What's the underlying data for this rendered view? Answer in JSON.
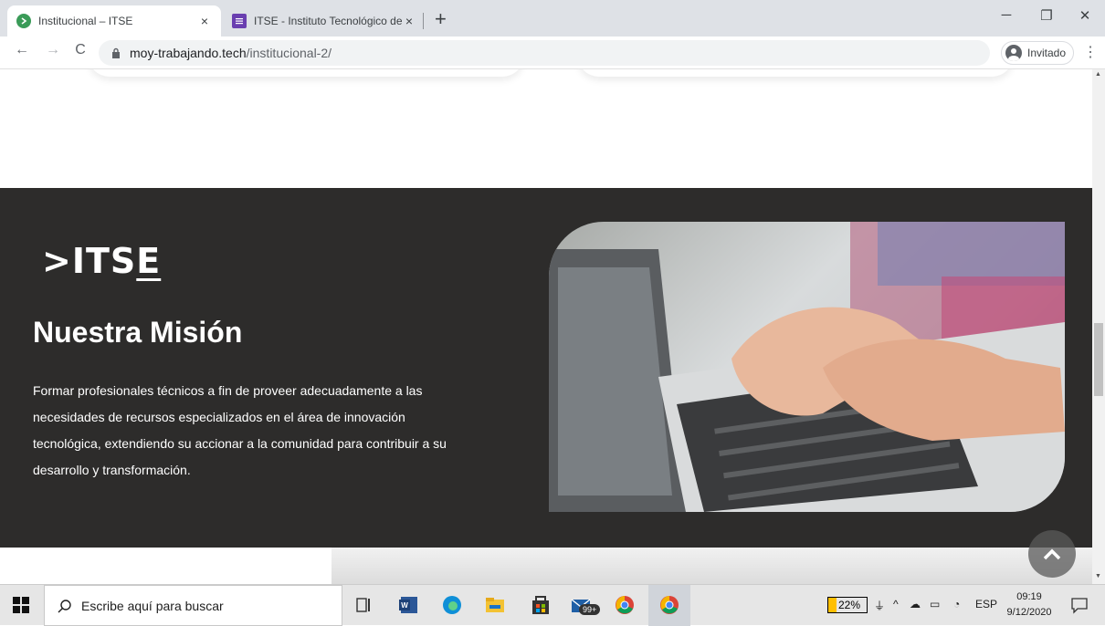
{
  "browser": {
    "tabs": [
      {
        "title": "Institucional – ITSE",
        "close": "×",
        "active": true
      },
      {
        "title": "ITSE - Instituto Tecnológico de Se",
        "close": "×",
        "active": false
      }
    ],
    "new_tab": "+",
    "window_controls": {
      "minimize": "─",
      "maximize": "❐",
      "close": "✕"
    },
    "nav": {
      "back": "←",
      "forward": "→",
      "reload": "C"
    },
    "url_host": "moy-trabajando.tech",
    "url_path": "/institucional-2/",
    "profile_label": "Invitado",
    "menu": "⋮"
  },
  "page": {
    "logo": {
      "prefix": ">ITS",
      "accent": "E"
    },
    "mission_title": "Nuestra Misión",
    "mission_text": "Formar profesionales técnicos a fin de proveer adecuadamente a las necesidades de recursos especializados en el área de innovación tecnológica, extendiendo su accionar a la comunidad para contribuir a su desarrollo y transformación.",
    "colors": {
      "section_bg": "#2d2c2b",
      "text": "#ffffff"
    }
  },
  "taskbar": {
    "search_placeholder": "Escribe aquí para buscar",
    "mail_badge": "99+",
    "battery_percent": "22%",
    "language": "ESP",
    "time": "09:19",
    "date": "9/12/2020"
  }
}
